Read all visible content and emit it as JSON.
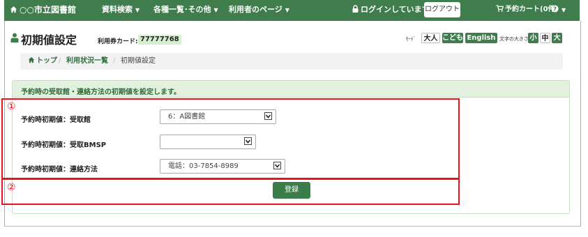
{
  "nav": {
    "library_name": "○○市立図書館",
    "items": [
      {
        "label": "資料検索"
      },
      {
        "label": "各種一覧･その他"
      },
      {
        "label": "利用者のページ"
      }
    ],
    "login_status": "ログインしています",
    "logout_label": "ログアウト",
    "cart_label": "予約カート(0件)"
  },
  "header": {
    "title": "初期値設定",
    "card_label": "利用券カード:",
    "card_number": "77777768"
  },
  "mode": {
    "label": "ﾓｰﾄﾞ",
    "options": [
      "大人",
      "こども",
      "English"
    ],
    "font_size_label": "文字の大きさ",
    "font_sizes": [
      "小",
      "中",
      "大"
    ]
  },
  "breadcrumb": {
    "items": [
      "トップ",
      "利用状況一覧",
      "初期値設定"
    ]
  },
  "panel": {
    "heading": "予約時の受取館・連絡方法の初期値を設定します。",
    "fields": [
      {
        "label": "予約時初期値：受取館",
        "value": "6：A図書館"
      },
      {
        "label": "予約時初期値：受取BMSP",
        "value": ""
      },
      {
        "label": "予約時初期値：連絡方法",
        "value": "電話：03-7854-8989"
      }
    ],
    "submit_label": "登録"
  },
  "annotations": {
    "marker_1": "①",
    "marker_2": "②"
  },
  "colors": {
    "brand_green": "#3f7d4c",
    "panel_header": "#e2f1de",
    "annotation_red": "#e8141c"
  }
}
